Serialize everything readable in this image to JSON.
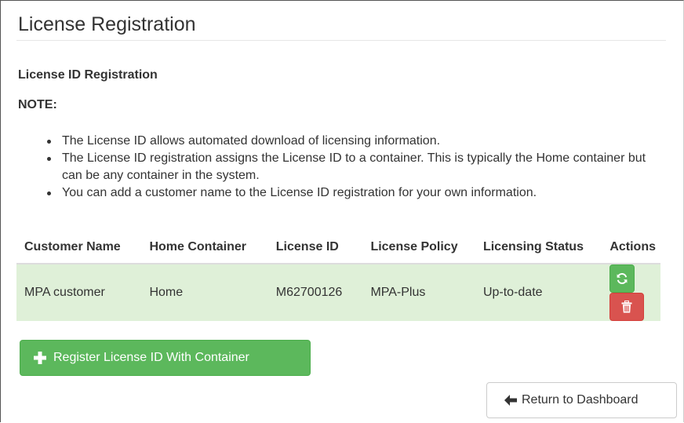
{
  "page": {
    "title": "License Registration"
  },
  "section": {
    "heading": "License ID Registration",
    "note_label": "NOTE:",
    "notes": [
      "The License ID allows automated download of licensing information.",
      "The License ID registration assigns the License ID to a container. This is typically the Home container but can be any container in the system.",
      "You can add a customer name to the License ID registration for your own information."
    ]
  },
  "table": {
    "headers": {
      "customer_name": "Customer Name",
      "home_container": "Home Container",
      "license_id": "License ID",
      "license_policy": "License Policy",
      "licensing_status": "Licensing Status",
      "actions": "Actions"
    },
    "rows": [
      {
        "customer_name": "MPA customer",
        "home_container": "Home",
        "license_id": "M62700126",
        "license_policy": "MPA-Plus",
        "licensing_status": "Up-to-date",
        "actions": [
          "refresh-icon",
          "trash-icon"
        ]
      }
    ]
  },
  "buttons": {
    "register_label": "Register License ID With Container",
    "register_icon": "plus-icon",
    "return_label": "Return to Dashboard",
    "return_icon": "arrow-left-icon"
  },
  "colors": {
    "success": "#5cb85c",
    "danger": "#d9534f",
    "row_success_bg": "#dff0d8"
  }
}
